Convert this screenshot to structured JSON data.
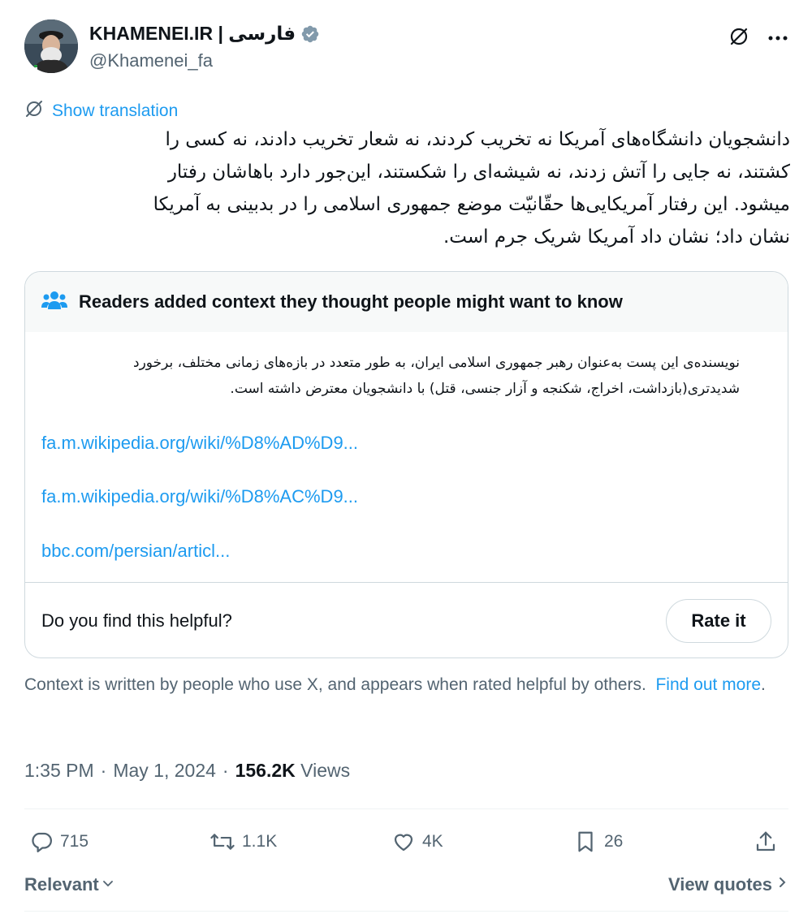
{
  "author": {
    "name": "KHAMENEI.IR | فارسی",
    "handle": "@Khamenei_fa",
    "verified": true
  },
  "translation_label": "Show translation",
  "tweet_text": "دانشجویان دانشگاه‌های آمریکا نه تخریب کردند، نه شعار تخریب دادند، نه کسی را\nکشتند، نه جایی را آتش زدند، نه شیشه‌ای را شکستند، این‌جور دارد باهاشان رفتار\nمیشود. این رفتار آمریکایی‌ها حقّانیّت موضع جمهوری اسلامی را در بدبینی به آمریکا\nنشان داد؛ نشان داد آمریکا شریک جرم است.",
  "community_note": {
    "heading": "Readers added context they thought people might want to know",
    "text": "نویسنده‌ی این پست به‌عنوان رهبر جمهوری اسلامی ایران، به طور متعدد در بازه‌های زمانی مختلف، برخورد\nشدیدتری(بازداشت، اخراج، شکنجه و آزار جنسی، قتل) با دانشجویان معترض داشته است.",
    "links": [
      "fa.m.wikipedia.org/wiki/%D8%AD%D9...",
      "fa.m.wikipedia.org/wiki/%D8%AC%D9...",
      "bbc.com/persian/articl..."
    ],
    "helpful_question": "Do you find this helpful?",
    "rate_label": "Rate it"
  },
  "context_disclaimer": "Context is written by people who use X, and appears when rated helpful by others.",
  "find_out_more": "Find out more",
  "meta": {
    "time": "1:35 PM",
    "date": "May 1, 2024",
    "views_count": "156.2K",
    "views_label": "Views",
    "separator": "·"
  },
  "actions": {
    "replies": "715",
    "reposts": "1.1K",
    "likes": "4K",
    "bookmarks": "26"
  },
  "sort_label": "Relevant",
  "view_quotes_label": "View quotes",
  "colors": {
    "accent": "#1d9bf0",
    "text": "#0f1419",
    "secondary": "#536471",
    "border": "#cfd9de"
  },
  "icons": [
    "verified-badge-icon",
    "grok-icon",
    "more-icon",
    "translate-icon",
    "community-notes-icon",
    "reply-icon",
    "repost-icon",
    "like-icon",
    "bookmark-icon",
    "share-icon",
    "chevron-down-icon",
    "chevron-right-icon"
  ]
}
